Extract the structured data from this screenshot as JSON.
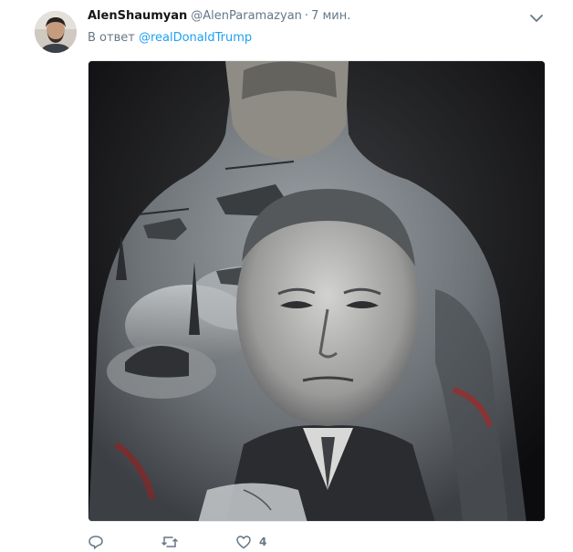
{
  "tweet": {
    "author_name": "AlenShaumyan",
    "author_handle": "@AlenParamazyan",
    "separator": "·",
    "time": "7 мин.",
    "reply_prefix": "В ответ",
    "reply_to": "@realDonaldTrump"
  },
  "actions": {
    "reply_count": "",
    "retweet_count": "",
    "like_count": "4"
  },
  "colors": {
    "link": "#1da1f2",
    "secondary_text": "#657786",
    "primary_text": "#14171a"
  },
  "icons": [
    "chevron-down-icon",
    "reply-icon",
    "retweet-icon",
    "heart-icon"
  ]
}
